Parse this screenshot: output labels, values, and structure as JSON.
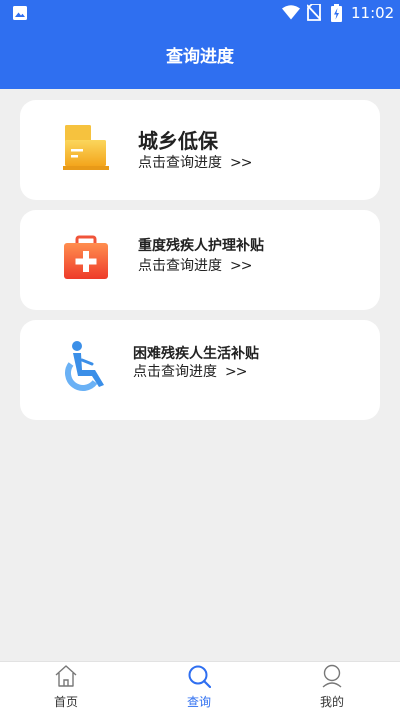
{
  "status_bar": {
    "time": "11:02"
  },
  "header": {
    "title": "查询进度"
  },
  "cards": [
    {
      "title": "城乡低保",
      "subtitle": "点击查询进度",
      "chevron": ">>",
      "icon": "document-stack-icon"
    },
    {
      "title": "重度残疾人护理补贴",
      "subtitle": "点击查询进度",
      "chevron": ">>",
      "icon": "medical-kit-icon"
    },
    {
      "title": "困难残疾人生活补贴",
      "subtitle": "点击查询进度",
      "chevron": ">>",
      "icon": "wheelchair-icon"
    }
  ],
  "tabs": [
    {
      "label": "首页",
      "icon": "home-icon",
      "active": false
    },
    {
      "label": "查询",
      "icon": "search-icon",
      "active": true
    },
    {
      "label": "我的",
      "icon": "user-icon",
      "active": false
    }
  ],
  "colors": {
    "primary": "#2f6ff0",
    "background": "#efefef",
    "card": "#ffffff"
  }
}
